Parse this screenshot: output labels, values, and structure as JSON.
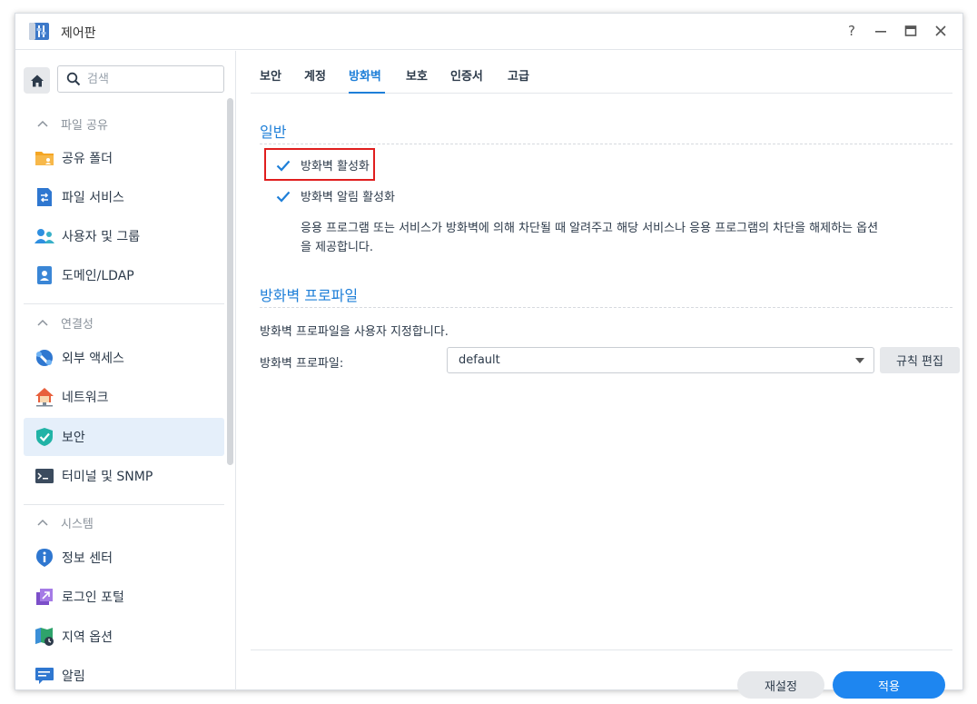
{
  "window": {
    "title": "제어판",
    "help": "?"
  },
  "sidebar": {
    "search_placeholder": "검색",
    "groups": {
      "file_sharing": "파일 공유",
      "connectivity": "연결성",
      "system": "시스템"
    },
    "items": {
      "shared_folder": "공유 폴더",
      "file_services": "파일 서비스",
      "user_group": "사용자 및 그룹",
      "domain_ldap": "도메인/LDAP",
      "external_access": "외부 액세스",
      "network": "네트워크",
      "security": "보안",
      "terminal_snmp": "터미널 및 SNMP",
      "info_center": "정보 센터",
      "login_portal": "로그인 포털",
      "regional_options": "지역 옵션",
      "notification": "알림"
    }
  },
  "tabs": {
    "security": "보안",
    "account": "계정",
    "firewall": "방화벽",
    "protection": "보호",
    "certificate": "인증서",
    "advanced": "고급"
  },
  "general": {
    "title": "일반",
    "enable_firewall": "방화벽 활성화",
    "enable_notifications": "방화벽 알림 활성화",
    "description_line1": "응용 프로그램 또는 서비스가 방화벽에 의해 차단될 때 알려주고 해당 서비스나 응용 프로그램의 차단을 해제하는 옵션",
    "description_line2": "을 제공합니다."
  },
  "profile": {
    "title": "방화벽 프로파일",
    "description": "방화벽 프로파일을 사용자 지정합니다.",
    "label": "방화벽 프로파일:",
    "value": "default",
    "edit_rules": "규칙 편집"
  },
  "footer": {
    "reset": "재설정",
    "apply": "적용"
  },
  "colors": {
    "accent": "#1e7fd8",
    "apply": "#1e86f0",
    "highlight": "#e01e1e"
  }
}
